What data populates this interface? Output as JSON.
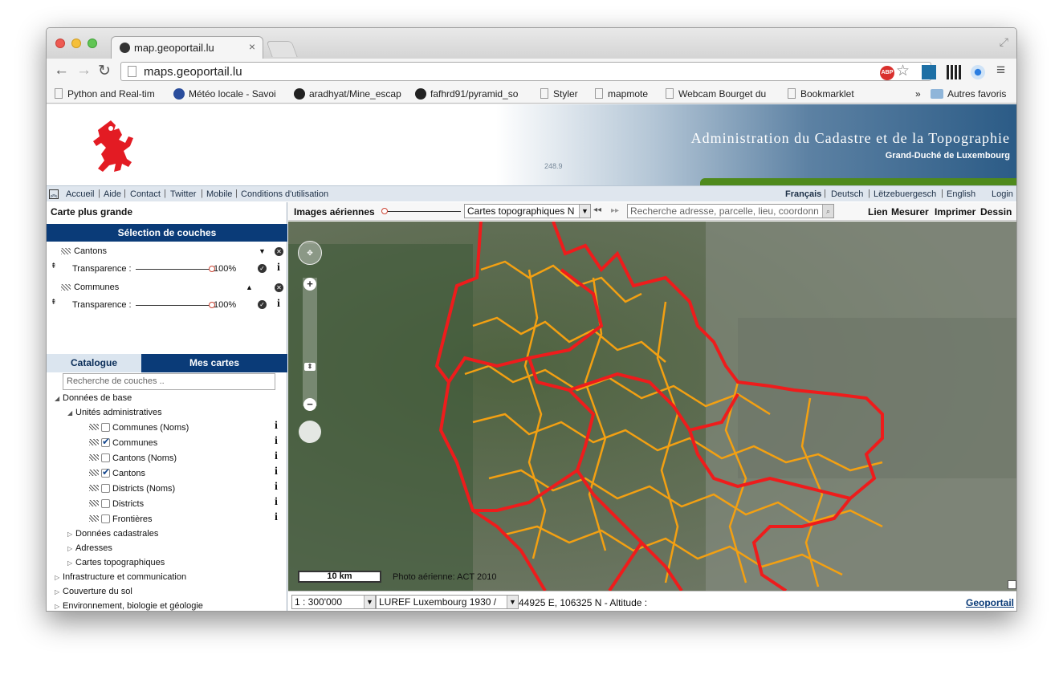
{
  "browser": {
    "tab_title": "map.geoportail.lu",
    "url": "maps.geoportail.lu",
    "bookmarks": [
      "Python and Real-tim",
      "Météo locale - Savoi",
      "aradhyat/Mine_escap",
      "fafhrd91/pyramid_so",
      "Styler",
      "mapmote",
      "Webcam Bourget du",
      "Bookmarklet"
    ],
    "bookmarks_more": "»",
    "other_bookmarks": "Autres favoris"
  },
  "header": {
    "title": "Administration du Cadastre et de la Topographie",
    "subtitle": "Grand-Duché de Luxembourg",
    "banner_number": "248.9"
  },
  "linkbar": {
    "links": [
      "Accueil",
      "Aide",
      "Contact",
      "Twitter",
      "Mobile",
      "Conditions d'utilisation"
    ],
    "languages": [
      "Français",
      "Deutsch",
      "Lëtzebuergesch",
      "English"
    ],
    "login": "Login"
  },
  "leftpanel": {
    "carte_plus_grande": "Carte plus grande",
    "selection_title": "Sélection de couches",
    "layers": [
      {
        "name": "Cantons",
        "transparency_label": "Transparence :",
        "transparency": "100%"
      },
      {
        "name": "Communes",
        "transparency_label": "Transparence :",
        "transparency": "100%"
      }
    ],
    "tabs": [
      "Catalogue",
      "Mes cartes"
    ],
    "search_placeholder": "Recherche de couches ..",
    "tree": {
      "donnees_de_base": "Données de base",
      "unites_admin": "Unités administratives",
      "items": [
        {
          "label": "Communes (Noms)",
          "checked": false
        },
        {
          "label": "Communes",
          "checked": true
        },
        {
          "label": "Cantons (Noms)",
          "checked": false
        },
        {
          "label": "Cantons",
          "checked": true
        },
        {
          "label": "Districts (Noms)",
          "checked": false
        },
        {
          "label": "Districts",
          "checked": false
        },
        {
          "label": "Frontières",
          "checked": false
        }
      ],
      "sub_folders": [
        "Données cadastrales",
        "Adresses",
        "Cartes topographiques"
      ],
      "top_folders": [
        "Infrastructure et communication",
        "Couverture du sol",
        "Environnement, biologie et géologie"
      ]
    }
  },
  "maptoolbar": {
    "base_layer": "Images aériennes",
    "overlay_select": "Cartes topographiques N",
    "search_placeholder": "Recherche adresse, parcelle, lieu, coordonn",
    "actions": [
      "Lien",
      "Mesurer",
      "Imprimer",
      "Dessin"
    ]
  },
  "map": {
    "scale_label": "10 km",
    "copyright": "Photo aérienne: ACT 2010"
  },
  "statusbar": {
    "scale": "1 : 300'000",
    "projection": "LUREF Luxembourg 1930 /",
    "coords": "44925 E, 106325 N  - Altitude :",
    "geoportail_link": "Geoportail"
  },
  "colors": {
    "brand_blue": "#0a3b78",
    "canton_border": "#ee1c1c",
    "commune_border": "#f3a012",
    "green_band": "#4f8a1c"
  }
}
